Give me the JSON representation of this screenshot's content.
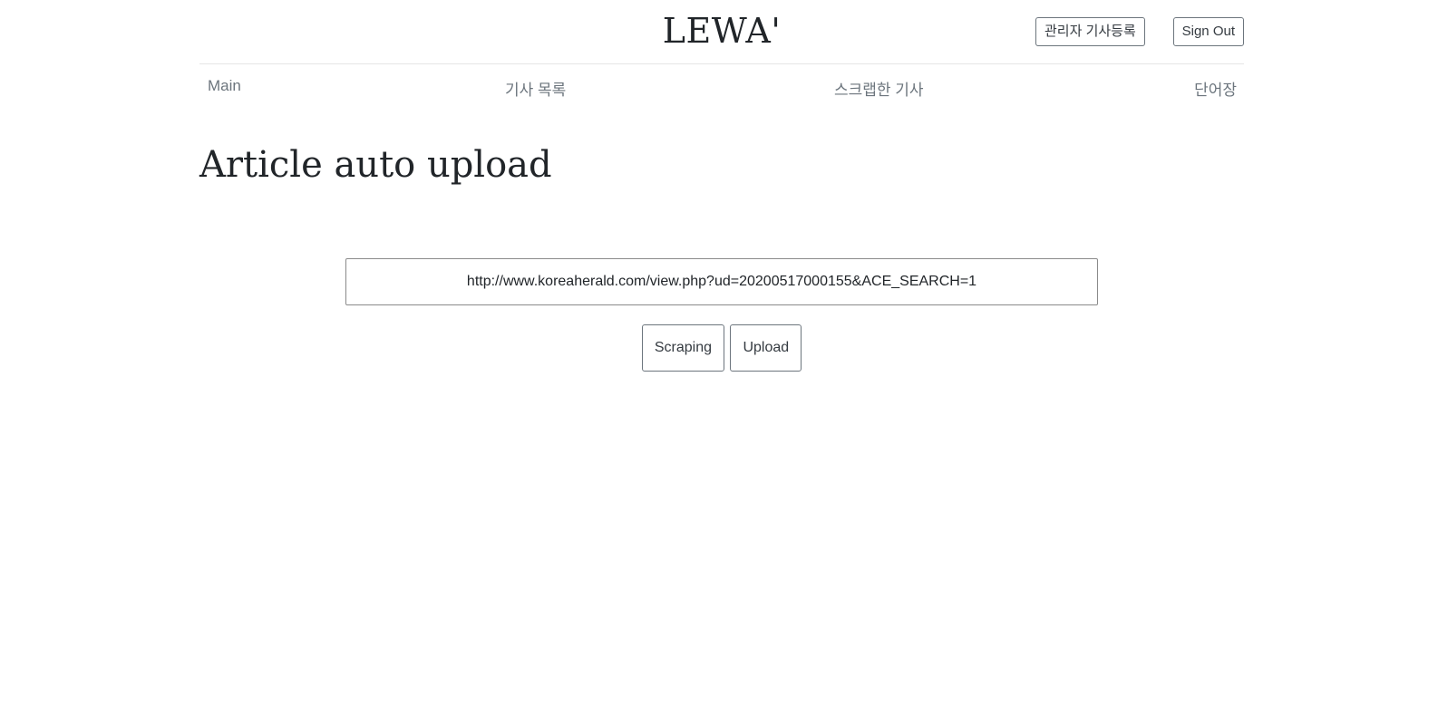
{
  "header": {
    "logo": "LEWA'",
    "admin_button": "관리자 기사등록",
    "signout_button": "Sign Out"
  },
  "nav": {
    "items": [
      {
        "label": "Main"
      },
      {
        "label": "기사 목록"
      },
      {
        "label": "스크랩한 기사"
      },
      {
        "label": "단어장"
      }
    ]
  },
  "main": {
    "title": "Article auto upload",
    "url_input": {
      "value": "http://www.koreaherald.com/view.php?ud=20200517000155&ACE_SEARCH=1"
    },
    "scraping_button": "Scraping",
    "upload_button": "Upload"
  }
}
